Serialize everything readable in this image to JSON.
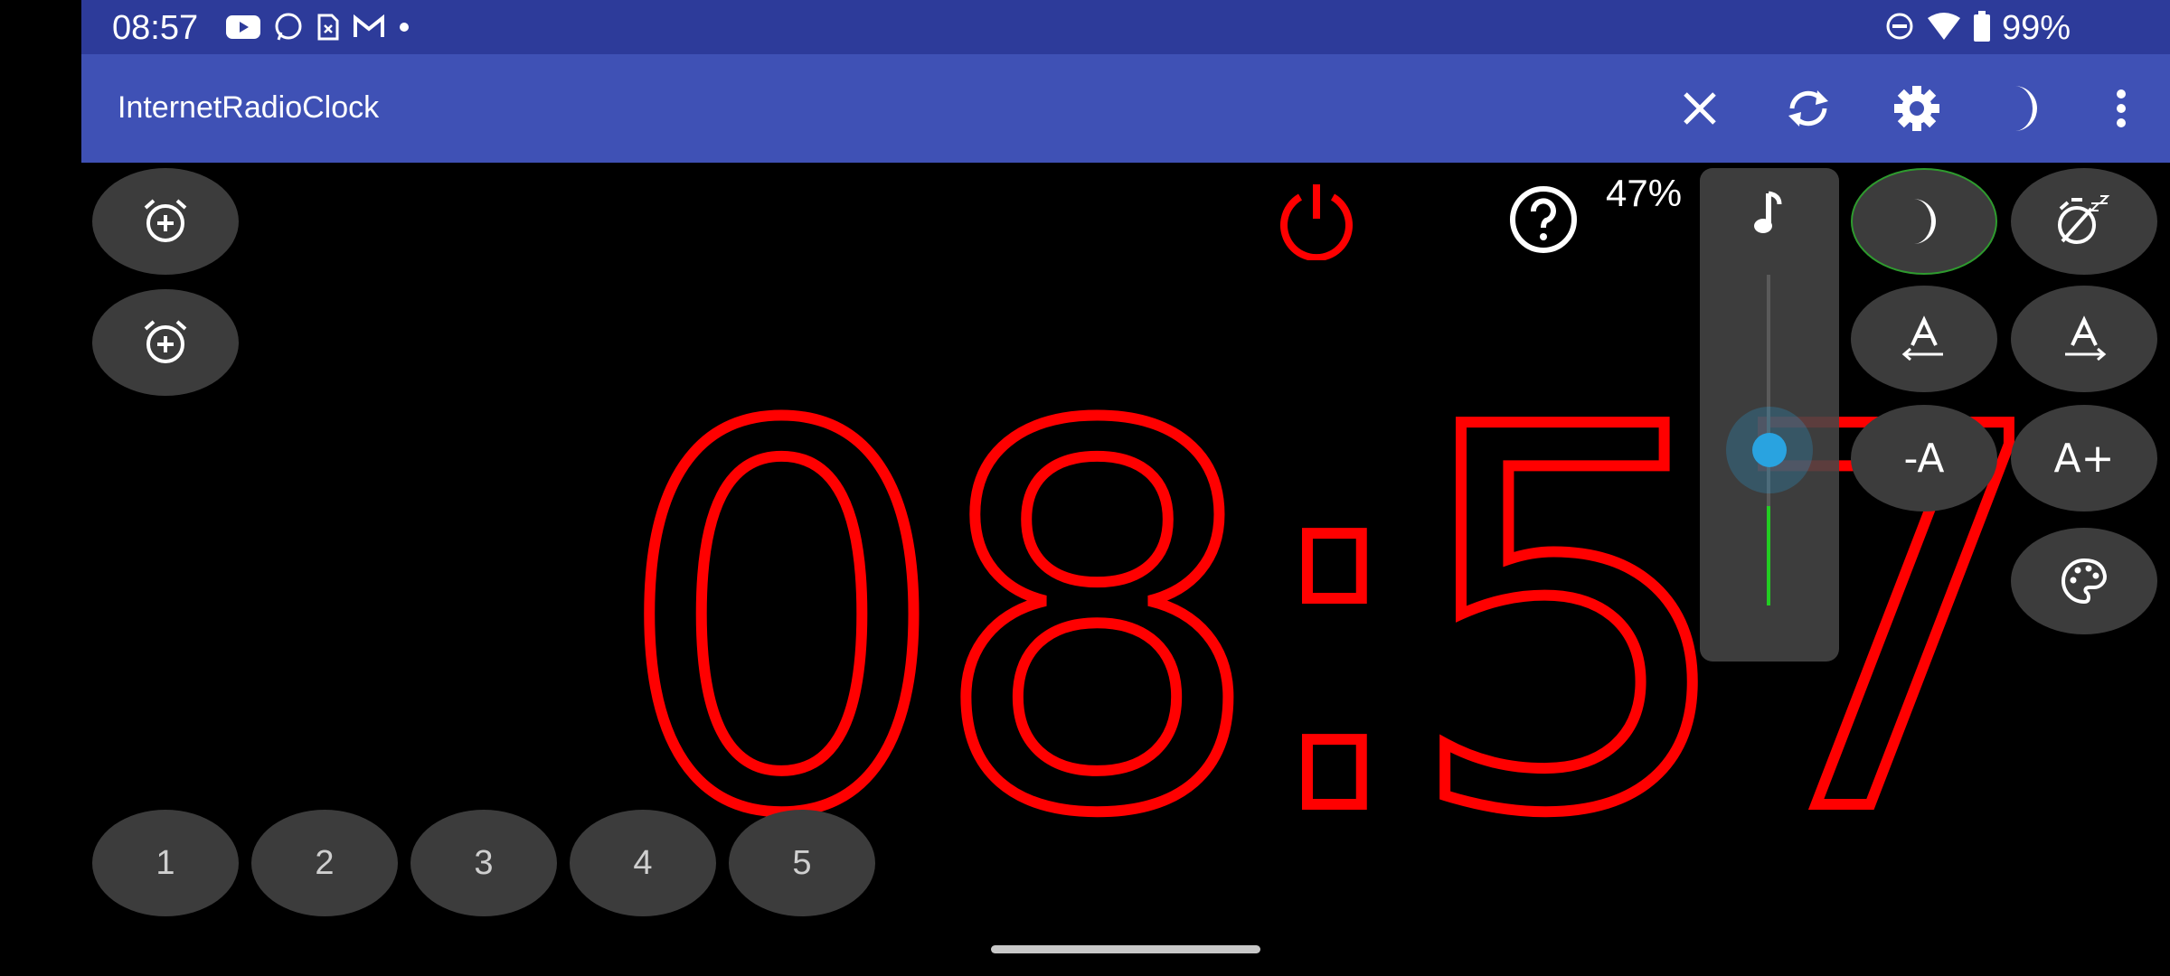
{
  "status_bar": {
    "time": "08:57",
    "battery": "99%",
    "notification_icons": [
      "youtube-icon",
      "whatsapp-icon",
      "sim-icon",
      "gmail-icon",
      "dot-icon"
    ],
    "system_icons": [
      "dnd-icon",
      "wifi-icon",
      "battery-icon"
    ]
  },
  "app_bar": {
    "title": "InternetRadioClock",
    "actions": [
      "close-icon",
      "sync-icon",
      "settings-icon",
      "night-mode-icon",
      "more-icon"
    ]
  },
  "clock": {
    "time": "08:57",
    "color": "#ff0000"
  },
  "volume": {
    "percent_label": "47%",
    "level": 0.47
  },
  "presets": [
    "1",
    "2",
    "3",
    "4",
    "5"
  ],
  "font_controls": {
    "decrease_label": "-A",
    "increase_label": "A+"
  },
  "colors": {
    "status_bar": "#2d3b9a",
    "app_bar": "#3f51b5",
    "button": "#3c3c3c",
    "accent_green": "#22cc22",
    "slider_blue": "#29a3e0"
  }
}
